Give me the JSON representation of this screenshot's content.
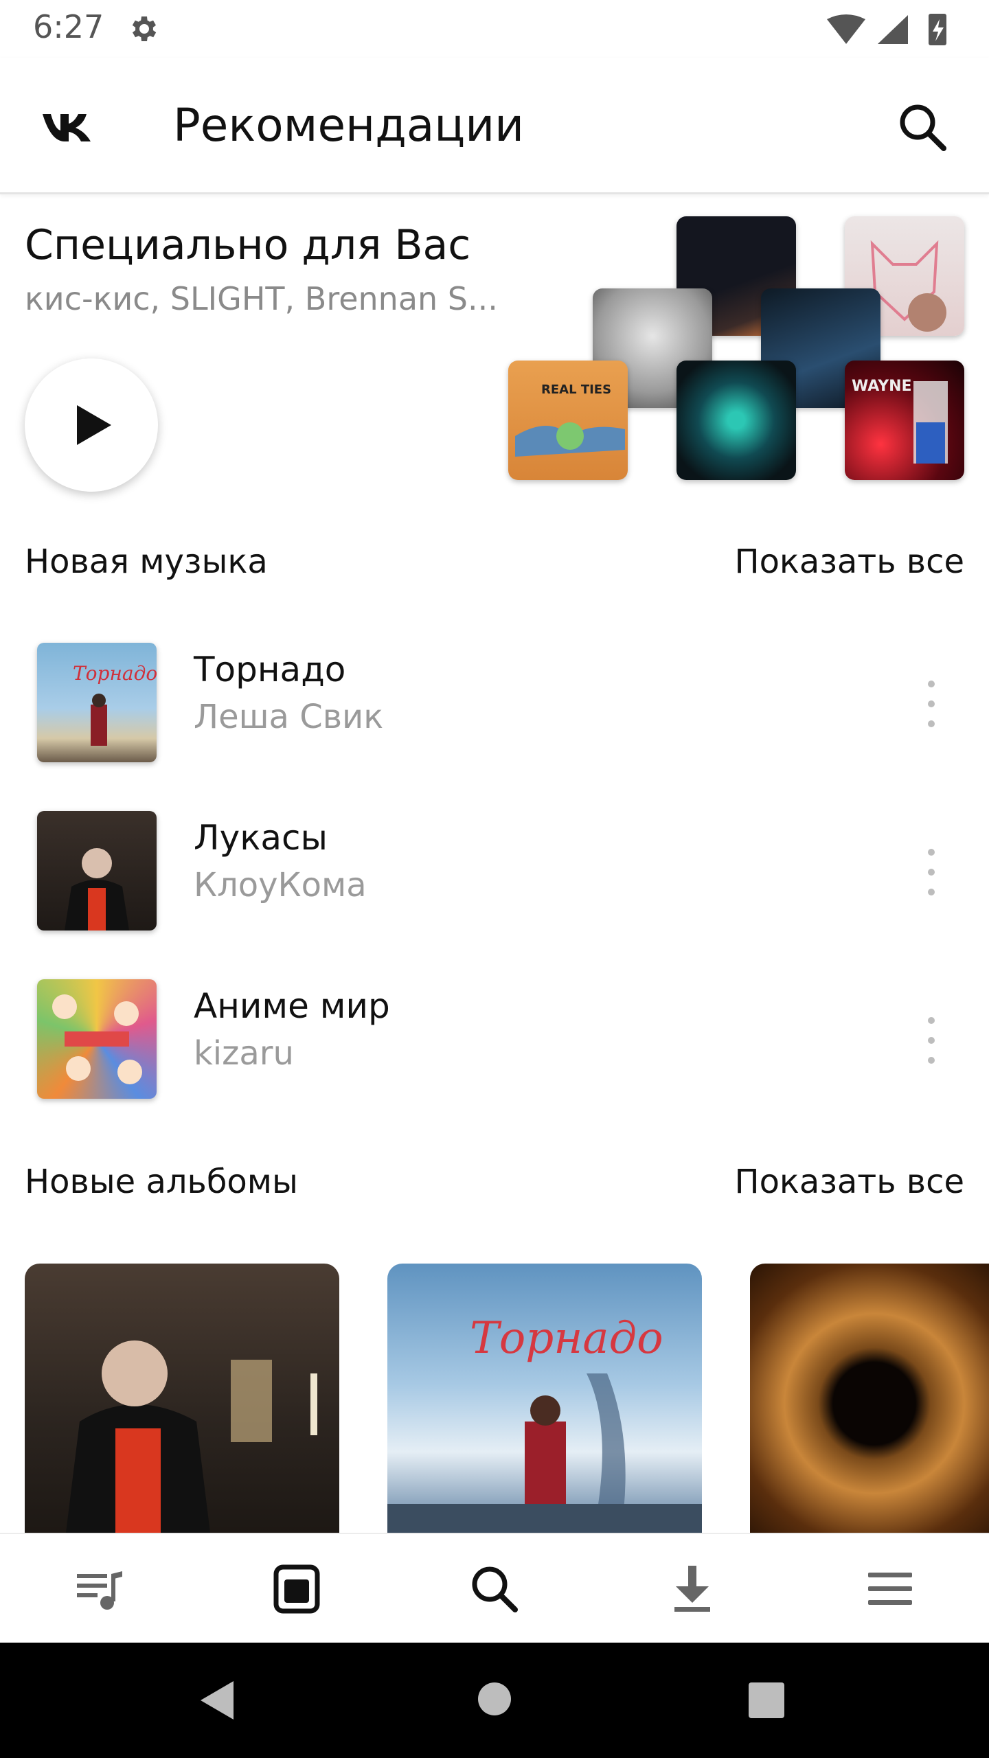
{
  "status_bar": {
    "time": "6:27",
    "icons": [
      "gear-icon",
      "wifi-icon",
      "signal-icon",
      "battery-charging-icon"
    ]
  },
  "app_bar": {
    "logo": "vk-logo",
    "title": "Рекомендации",
    "search_icon": "search-icon"
  },
  "special": {
    "title": "Специально для Вас",
    "subtitle": "кис-кис, SLIGHT, Brennan S...",
    "play_icon": "play-icon",
    "covers": [
      {
        "colors": [
          "#1a1c2a",
          "#e07a3a"
        ]
      },
      {
        "colors": [
          "#e9e2e2",
          "#e98a9a"
        ]
      },
      {
        "colors": [
          "#cfcfcf",
          "#5a5a5a"
        ]
      },
      {
        "colors": [
          "#14283a",
          "#4d7fa8"
        ]
      },
      {
        "colors": [
          "#e79a45",
          "#7dc870"
        ]
      },
      {
        "colors": [
          "#122029",
          "#1fb7a8"
        ]
      },
      {
        "colors": [
          "#300308",
          "#d7202c"
        ]
      }
    ]
  },
  "new_music": {
    "heading": "Новая музыка",
    "show_all": "Показать все",
    "tracks": [
      {
        "title": "Торнадо",
        "artist": "Леша Свик",
        "art_colors": [
          "#7fb4d8",
          "#c83a3a"
        ]
      },
      {
        "title": "Лукасы",
        "artist": "КлоуКома",
        "art_colors": [
          "#2a2420",
          "#d9371f"
        ]
      },
      {
        "title": "Аниме мир",
        "artist": "kizaru",
        "art_colors": [
          "#f1c646",
          "#e05a8c"
        ]
      }
    ]
  },
  "new_albums": {
    "heading": "Новые альбомы",
    "show_all": "Показать все",
    "albums": [
      {
        "art_colors": [
          "#3b3028",
          "#d82e1c"
        ]
      },
      {
        "art_colors": [
          "#6f9ec7",
          "#d63840"
        ]
      },
      {
        "art_colors": [
          "#5a2e0d",
          "#c9863a"
        ]
      }
    ]
  },
  "bottom_nav": {
    "items": [
      "my-music-icon",
      "recommendations-icon",
      "search-icon",
      "downloads-icon",
      "menu-icon"
    ],
    "active_index": 1
  },
  "system_nav": [
    "back-icon",
    "home-icon",
    "recents-icon"
  ]
}
